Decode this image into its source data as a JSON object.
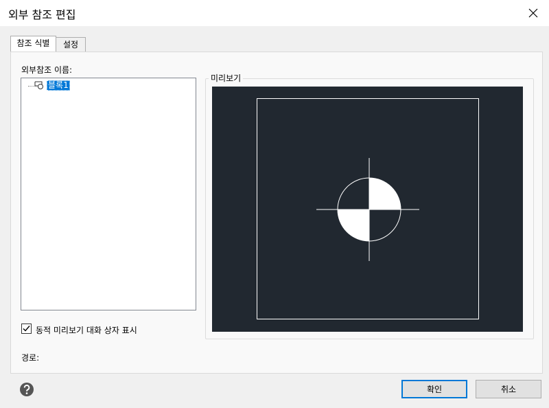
{
  "window": {
    "title": "외부 참조 편집"
  },
  "tabs": [
    {
      "label": "참조 식별",
      "active": true
    },
    {
      "label": "설정",
      "active": false
    }
  ],
  "left": {
    "list_label": "외부참조 이름:",
    "tree_items": [
      {
        "label": "블록1",
        "selected": true,
        "icon": "block-reference-icon"
      }
    ],
    "checkbox": {
      "label": "동적 미리보기 대화 상자 표시",
      "checked": true
    },
    "path_label": "경로:"
  },
  "preview": {
    "label": "미리보기",
    "background": "#212830"
  },
  "footer": {
    "ok_label": "확인",
    "cancel_label": "취소",
    "help_icon": "help-icon"
  },
  "colors": {
    "selection": "#0078d7",
    "preview_bg": "#212830"
  }
}
